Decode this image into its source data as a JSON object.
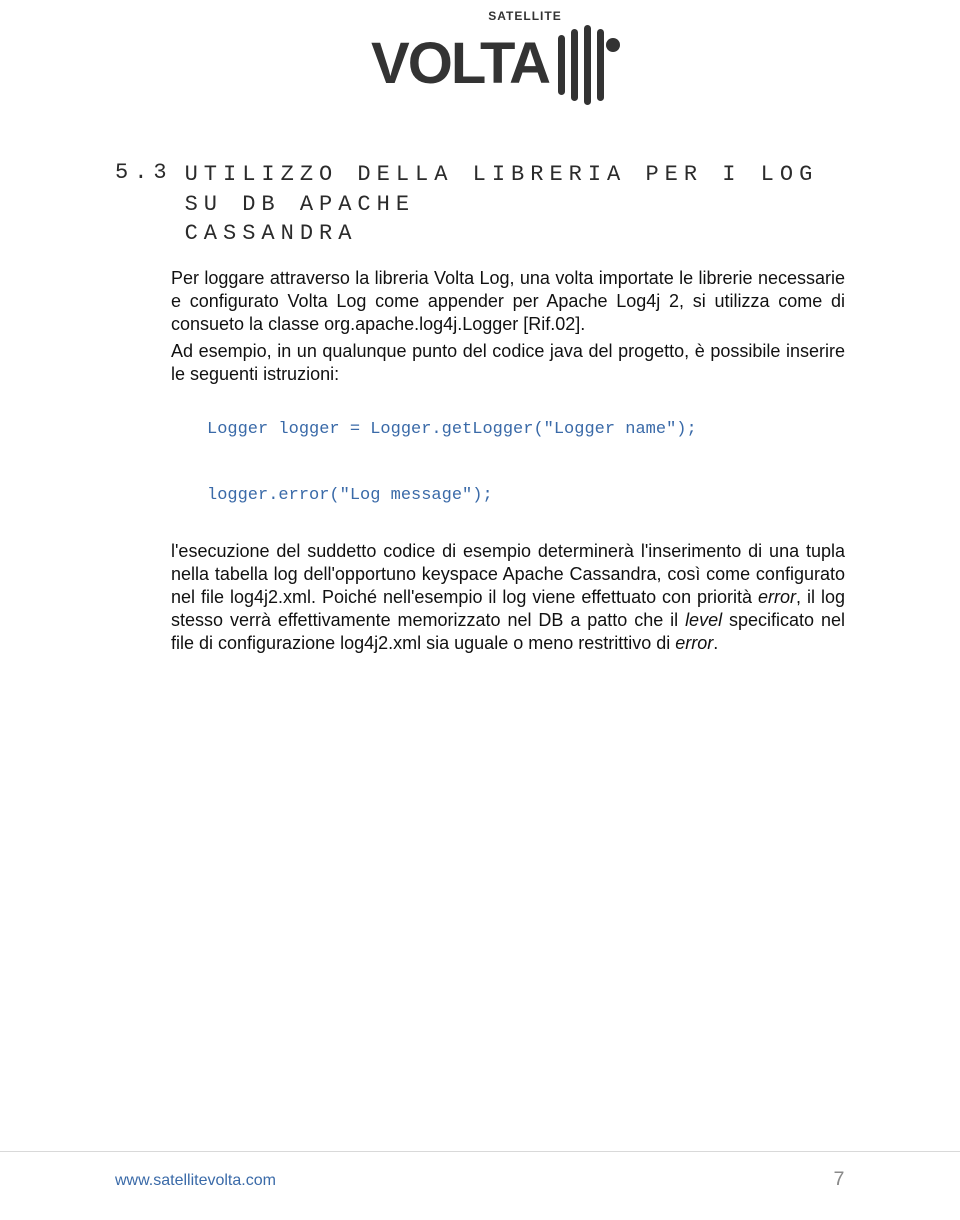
{
  "logo": {
    "top_text": "SATELLITE",
    "main_text": "VOLTA"
  },
  "section": {
    "number": "5.3",
    "title_line1": "Utilizzo della libreria per i log su DB Apache",
    "title_line2": "Cassandra"
  },
  "para1": "Per loggare attraverso la libreria Volta Log, una volta importate le librerie necessarie e configurato Volta Log come appender per Apache Log4j 2, si utilizza come di consueto la classe org.apache.log4j.Logger [Rif.02].",
  "para2": "Ad esempio, in un qualunque punto del codice java del progetto, è possibile inserire le seguenti istruzioni:",
  "code": {
    "line1": "Logger logger = Logger.getLogger(\"Logger name\");",
    "line2": "logger.error(\"Log message\");"
  },
  "para3_a": "l'esecuzione del suddetto codice di esempio determinerà l'inserimento di una tupla nella tabella log dell'opportuno keyspace Apache Cassandra, così come configurato nel file log4j2.xml. Poiché nell'esempio il log viene effettuato con priorità ",
  "para3_err1": "error",
  "para3_b": ", il log stesso verrà effettivamente memorizzato nel DB a patto che il ",
  "para3_level": "level",
  "para3_c": " specificato nel file di configurazione log4j2.xml sia uguale o meno restrittivo di ",
  "para3_err2": "error",
  "para3_d": ".",
  "footer": {
    "url": "www.satellitevolta.com",
    "page": "7"
  }
}
